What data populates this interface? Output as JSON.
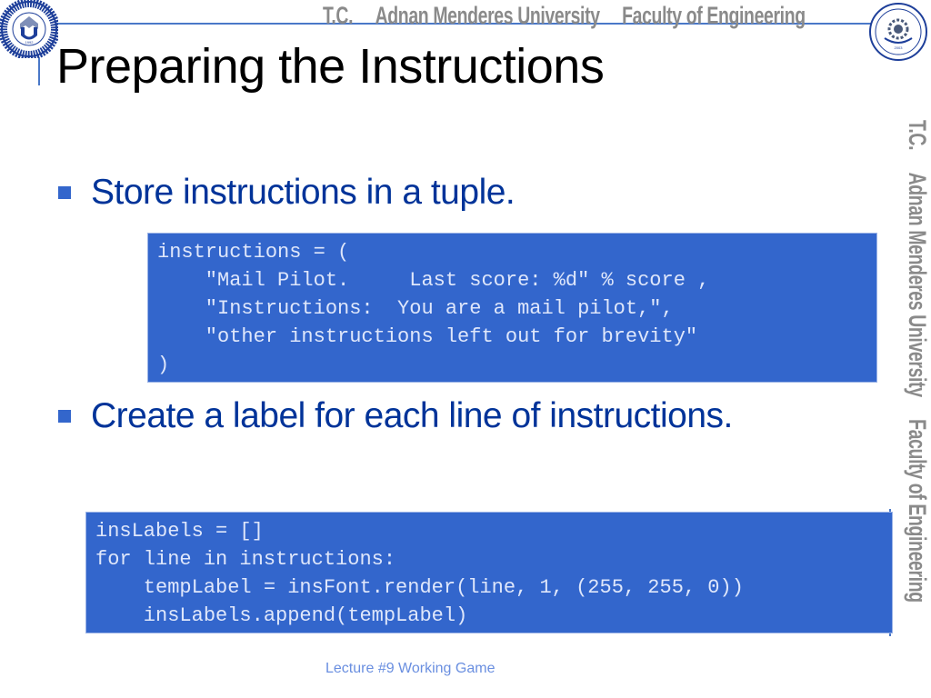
{
  "header": {
    "banner_parts": [
      "T.C.",
      "Adnan Menderes University",
      "Faculty of Engineering"
    ],
    "left_logo": {
      "icon": "university-seal-icon",
      "ring_text": "ADNAN MENDERES ÜNİVERSİTESİ",
      "year": "1992"
    },
    "right_logo": {
      "icon": "engineering-faculty-seal-icon",
      "ring_text": "ADNAN MENDERES UNIVERSITY ENGINEERING FACULTY",
      "year": "2003"
    }
  },
  "side_banner": {
    "parts": [
      "T.C.",
      "Adnan Menderes University",
      "Faculty of Engineering"
    ]
  },
  "slide": {
    "title": "Preparing the Instructions",
    "bullets": [
      {
        "text": "Store instructions in a tuple.",
        "code": [
          "instructions = (",
          "    \"Mail Pilot.     Last score: %d\" % score ,",
          "    \"Instructions:  You are a mail pilot,\",",
          "    \"other instructions left out for brevity\"",
          ")"
        ]
      },
      {
        "text": "Create a label for each line of instructions.",
        "code": [
          "insLabels = []",
          "for line in instructions:",
          "    tempLabel = insFont.render(line, 1, (255, 255, 0))",
          "    insLabels.append(tempLabel)"
        ]
      }
    ]
  },
  "footer": {
    "text": "Lecture #9 Working Game"
  },
  "colors": {
    "accent_blue": "#3366cc",
    "bullet_text": "#003399",
    "code_text": "#dfe7fb",
    "banner_gray": "#8a8a8a",
    "footer_text": "#6a8fe0"
  }
}
